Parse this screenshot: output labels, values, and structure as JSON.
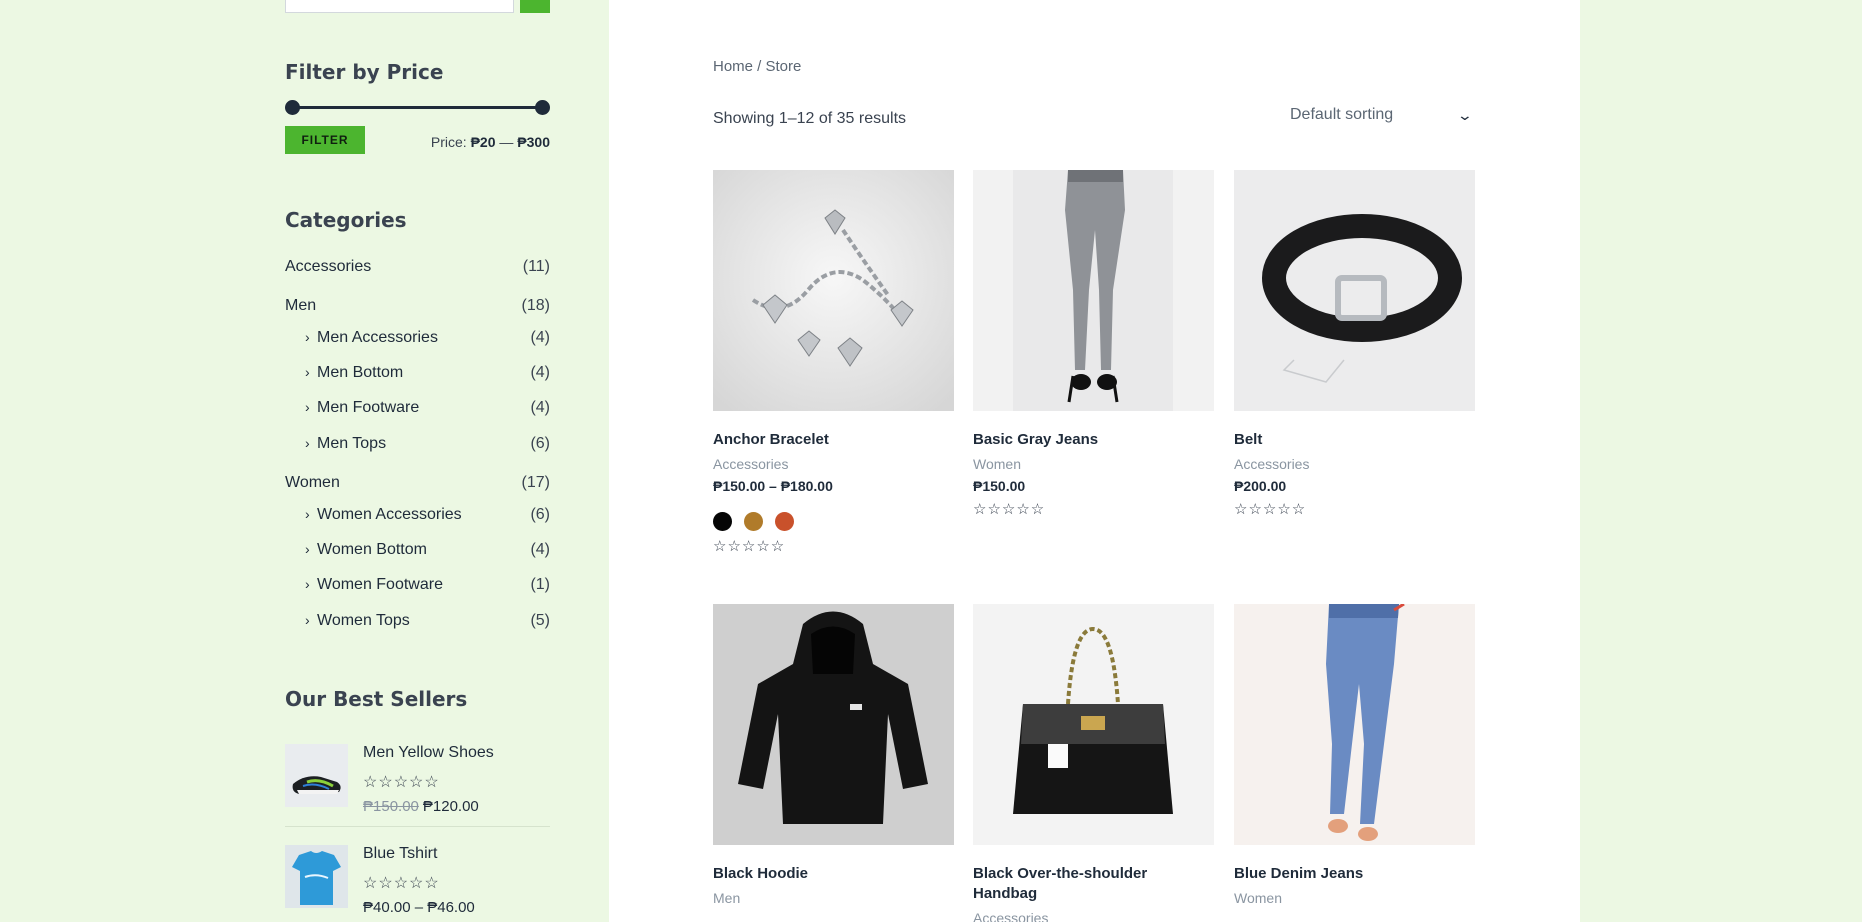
{
  "sidebar": {
    "filter_title": "Filter by Price",
    "filter_button": "FILTER",
    "price_prefix": "Price:",
    "price_min": "₱20",
    "price_sep": "—",
    "price_max": "₱300",
    "categories_title": "Categories",
    "categories": [
      {
        "label": "Accessories",
        "count": "(11)"
      },
      {
        "label": "Men",
        "count": "(18)"
      },
      {
        "label": "Men Accessories",
        "count": "(4)"
      },
      {
        "label": "Men Bottom",
        "count": "(4)"
      },
      {
        "label": "Men Footware",
        "count": "(4)"
      },
      {
        "label": "Men Tops",
        "count": "(6)"
      },
      {
        "label": "Women",
        "count": "(17)"
      },
      {
        "label": "Women Accessories",
        "count": "(6)"
      },
      {
        "label": "Women Bottom",
        "count": "(4)"
      },
      {
        "label": "Women Footware",
        "count": "(1)"
      },
      {
        "label": "Women Tops",
        "count": "(5)"
      }
    ],
    "best_sellers_title": "Our Best Sellers",
    "best_sellers": [
      {
        "name": "Men Yellow Shoes",
        "old_price": "₱150.00",
        "price": "₱120.00"
      },
      {
        "name": "Blue Tshirt",
        "price": "₱40.00 – ₱46.00"
      }
    ]
  },
  "main": {
    "breadcrumb": "Home / Store",
    "results": "Showing 1–12 of 35 results",
    "sort": "Default sorting",
    "products": [
      {
        "title": "Anchor Bracelet",
        "category": "Accessories",
        "price": "₱150.00 – ₱180.00",
        "swatches": [
          "#050505",
          "#b07b2a",
          "#c9512b"
        ]
      },
      {
        "title": "Basic Gray Jeans",
        "category": "Women",
        "price": "₱150.00"
      },
      {
        "title": "Belt",
        "category": "Accessories",
        "price": "₱200.00"
      },
      {
        "title": "Black Hoodie",
        "category": "Men"
      },
      {
        "title": "Black Over-the-shoulder Handbag",
        "category": "Accessories"
      },
      {
        "title": "Blue Denim Jeans",
        "category": "Women"
      }
    ],
    "stars": "☆☆☆☆☆"
  },
  "colors": {
    "brand_green": "#4cb52f",
    "sidebar_bg": "#ecf8e3",
    "text_dark": "#1f2b3a"
  }
}
